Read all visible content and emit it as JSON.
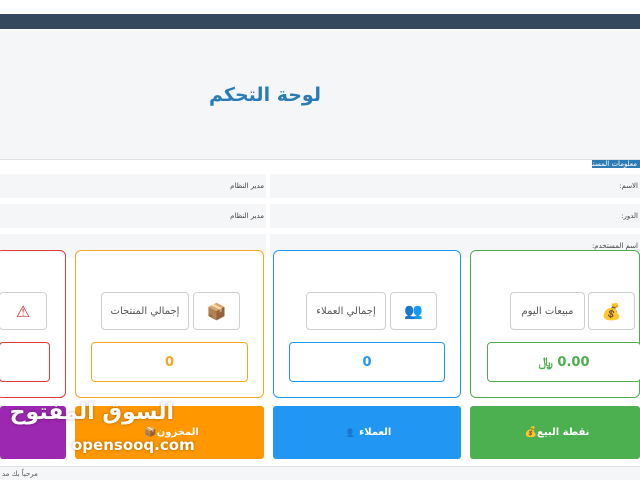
{
  "header": {
    "title": "لوحة التحكم"
  },
  "user_info": {
    "legend": "معلومات المستخدم",
    "rows": [
      {
        "label": "الاسم:",
        "value": "مدير النظام"
      },
      {
        "label": "الدور:",
        "value": "مدير النظام"
      },
      {
        "label": "اسم المستخدم:",
        "value": ""
      }
    ]
  },
  "cards": [
    {
      "label": "مبيعات اليوم",
      "icon": "money-bag-icon",
      "icon_glyph": "💰",
      "value": "0.00 ﷼",
      "color": "#4cae4c"
    },
    {
      "label": "إجمالي العملاء",
      "icon": "users-icon",
      "icon_glyph": "👥",
      "value": "0",
      "color": "#2196f3"
    },
    {
      "label": "إجمالي المنتجات",
      "icon": "box-icon",
      "icon_glyph": "📦",
      "value": "0",
      "color": "#f5a623"
    },
    {
      "label": "",
      "icon": "warning-icon",
      "icon_glyph": "⚠",
      "value": "",
      "color": "#e53935"
    }
  ],
  "buttons": [
    {
      "label": "نقطة البيع",
      "icon_glyph": "💰",
      "color": "#4caf50"
    },
    {
      "label": "العملاء",
      "icon_glyph": "👥",
      "color": "#2196f3"
    },
    {
      "label": "المخزون",
      "icon_glyph": "📦",
      "color": "#ff9800"
    },
    {
      "label": "",
      "icon_glyph": "",
      "color": "#9c27b0"
    }
  ],
  "watermark": {
    "arabic": "السوق المفتوح",
    "english": "opensooq.com"
  },
  "footer": {
    "text": "مرحباً بك مد"
  }
}
